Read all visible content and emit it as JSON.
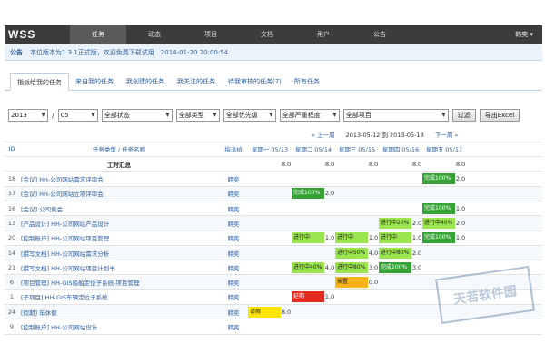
{
  "app": {
    "logo": "WSS",
    "user": "韩奕"
  },
  "nav": [
    "任务",
    "动态",
    "项目",
    "文档",
    "用户",
    "公告"
  ],
  "notice": {
    "label": "公告",
    "text": "本位版本为1.3.1正式版，欢迎免费下载试用　2014-01-20 20:00:54"
  },
  "tabs": [
    "指派给我的任务",
    "来自我的任务",
    "我创建的任务",
    "我关注的任务",
    "待我审核的任务(7)",
    "所有任务"
  ],
  "filters": {
    "year": "2013",
    "sep": "/",
    "month": "05",
    "status": "全部状态",
    "type": "全部类型",
    "priority": "全部优先级",
    "severity": "全部严重程度",
    "project": "全部项目",
    "filter_btn": "过滤",
    "export_btn": "导出Excel"
  },
  "grid": {
    "col_id": "ID",
    "col_type": "任务类型",
    "col_sep": "/",
    "col_name": "任务名称",
    "col_owner": "指派给",
    "prev_week": "« 上一周",
    "range": "2013-05-12 到 2013-05-18",
    "next_week": "下一周",
    "days": [
      "星期一 05/13",
      "星期二 05/14",
      "星期三 05/15",
      "星期四 05/16",
      "星期五 05/17"
    ],
    "summary_label": "工时汇总",
    "summary_values": [
      "8.0",
      "8.0",
      "8.0",
      "8.0",
      "8.0"
    ],
    "rows": [
      {
        "id": "18",
        "name": "[会议] HH-公司网站需求评审会",
        "owner": "韩奕",
        "cells": [
          {
            "t": "",
            "v": "",
            "c": ""
          },
          {
            "t": "",
            "v": "",
            "c": ""
          },
          {
            "t": "",
            "v": "",
            "c": ""
          },
          {
            "t": "",
            "v": "",
            "c": ""
          },
          {
            "t": "完成100%",
            "v": "2.0",
            "c": "dgreen"
          }
        ]
      },
      {
        "id": "17",
        "name": "[会议] HH-公司网站立项评审会",
        "owner": "韩奕",
        "cells": [
          {
            "t": "",
            "v": "",
            "c": ""
          },
          {
            "t": "完成100%",
            "v": "2.0",
            "c": "dgreen"
          },
          {
            "t": "",
            "v": "",
            "c": ""
          },
          {
            "t": "",
            "v": "",
            "c": ""
          },
          {
            "t": "",
            "v": "",
            "c": ""
          }
        ]
      },
      {
        "id": "16",
        "name": "[会议] 公司例会",
        "owner": "韩奕",
        "cells": [
          {
            "t": "",
            "v": "",
            "c": ""
          },
          {
            "t": "",
            "v": "",
            "c": ""
          },
          {
            "t": "",
            "v": "",
            "c": ""
          },
          {
            "t": "",
            "v": "",
            "c": ""
          },
          {
            "t": "完成100%",
            "v": "1.0",
            "c": "dgreen"
          }
        ]
      },
      {
        "id": "13",
        "name": "[产品设计] HH-公司网站产品设计",
        "owner": "韩奕",
        "cells": [
          {
            "t": "",
            "v": "",
            "c": ""
          },
          {
            "t": "",
            "v": "",
            "c": ""
          },
          {
            "t": "",
            "v": "",
            "c": ""
          },
          {
            "t": "进行中20%",
            "v": "2.0",
            "c": "green"
          },
          {
            "t": "进行中40%",
            "v": "2.0",
            "c": "green"
          }
        ]
      },
      {
        "id": "20",
        "name": "[控制账户] HH-公司网站项目管理",
        "owner": "韩奕",
        "cells": [
          {
            "t": "",
            "v": "",
            "c": ""
          },
          {
            "t": "进行中",
            "v": "1.0",
            "c": "green"
          },
          {
            "t": "进行中",
            "v": "1.0",
            "c": "green"
          },
          {
            "t": "进行中",
            "v": "1.0",
            "c": "green"
          },
          {
            "t": "完成100%",
            "v": "1.0",
            "c": "dgreen"
          }
        ]
      },
      {
        "id": "14",
        "name": "[撰写文档] HH-公司网站需求分析",
        "owner": "韩奕",
        "cells": [
          {
            "t": "",
            "v": "",
            "c": ""
          },
          {
            "t": "",
            "v": "",
            "c": ""
          },
          {
            "t": "进行中50%",
            "v": "4.0",
            "c": "green"
          },
          {
            "t": "进行中80%",
            "v": "2.0",
            "c": "green"
          },
          {
            "t": "",
            "v": "",
            "c": ""
          }
        ]
      },
      {
        "id": "21",
        "name": "[撰写文档] HH-公司网站项目计划书",
        "owner": "韩奕",
        "cells": [
          {
            "t": "",
            "v": "",
            "c": ""
          },
          {
            "t": "进行中40%",
            "v": "4.0",
            "c": "green"
          },
          {
            "t": "进行中80%",
            "v": "3.0",
            "c": "green"
          },
          {
            "t": "完成100%",
            "v": "3.0",
            "c": "dgreen"
          },
          {
            "t": "",
            "v": "",
            "c": ""
          }
        ]
      },
      {
        "id": "6",
        "name": "[项目管理] HH-GIS船舶定位子系统-项目管理",
        "owner": "韩奕",
        "cells": [
          {
            "t": "",
            "v": "",
            "c": ""
          },
          {
            "t": "",
            "v": "",
            "c": ""
          },
          {
            "t": "搁置",
            "v": "0.0",
            "c": "orange"
          },
          {
            "t": "",
            "v": "",
            "c": ""
          },
          {
            "t": "",
            "v": "",
            "c": ""
          }
        ]
      },
      {
        "id": "1",
        "name": "[子项目] HH-GIS车辆定位子系统",
        "owner": "韩奕",
        "cells": [
          {
            "t": "",
            "v": "",
            "c": ""
          },
          {
            "t": "延期",
            "v": "1.0",
            "c": "red"
          },
          {
            "t": "",
            "v": "",
            "c": ""
          },
          {
            "t": "",
            "v": "",
            "c": ""
          },
          {
            "t": "",
            "v": "",
            "c": ""
          }
        ]
      },
      {
        "id": "24",
        "name": "[假期] 年休假",
        "owner": "韩奕",
        "cells": [
          {
            "t": "请假",
            "v": "8.0",
            "c": "yellow"
          },
          {
            "t": "",
            "v": "",
            "c": ""
          },
          {
            "t": "",
            "v": "",
            "c": ""
          },
          {
            "t": "",
            "v": "",
            "c": ""
          },
          {
            "t": "",
            "v": "",
            "c": ""
          }
        ]
      },
      {
        "id": "9",
        "name": "[控制账户] HH-公司网站设计",
        "owner": "韩奕",
        "cells": [
          {
            "t": "",
            "v": "",
            "c": ""
          },
          {
            "t": "",
            "v": "",
            "c": ""
          },
          {
            "t": "",
            "v": "",
            "c": ""
          },
          {
            "t": "",
            "v": "",
            "c": ""
          },
          {
            "t": "",
            "v": "",
            "c": ""
          }
        ]
      }
    ]
  },
  "watermark": "天若软件园"
}
